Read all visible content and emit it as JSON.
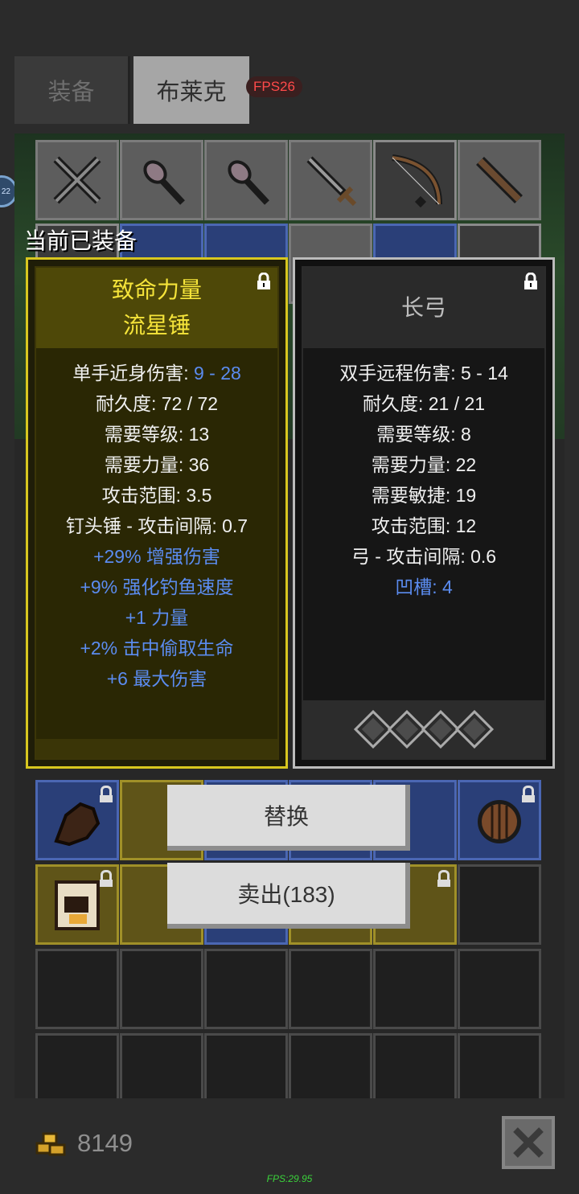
{
  "tabs": [
    {
      "label": "装备",
      "active": false
    },
    {
      "label": "布莱克",
      "active": true
    }
  ],
  "fps_badge": "FPS26",
  "side_bubble": "22",
  "section_label": "当前已装备",
  "equipped_item": {
    "name": "致命力量",
    "subtitle": "流星锤",
    "locked": true,
    "lines": [
      {
        "label": "单手近身伤害: ",
        "value": "9 - 28",
        "value_color": "blue"
      },
      {
        "label": "耐久度: 72 / 72"
      },
      {
        "label": "需要等级: 13"
      },
      {
        "label": "需要力量: 36"
      },
      {
        "label": "攻击范围: 3.5"
      },
      {
        "label": "钉头锤 - 攻击间隔: 0.7"
      },
      {
        "label": "+29% 增强伤害",
        "color": "blue"
      },
      {
        "label": "+9% 强化钓鱼速度",
        "color": "blue"
      },
      {
        "label": "+1 力量",
        "color": "blue"
      },
      {
        "label": "+2% 击中偷取生命",
        "color": "blue"
      },
      {
        "label": "+6 最大伤害",
        "color": "blue"
      }
    ]
  },
  "compare_item": {
    "name": "长弓",
    "locked": true,
    "lines": [
      {
        "label": "双手远程伤害: 5 - 14"
      },
      {
        "label": "耐久度: 21 / 21"
      },
      {
        "label": "需要等级: 8"
      },
      {
        "label": "需要力量: 22"
      },
      {
        "label": "需要敏捷: 19"
      },
      {
        "label": "攻击范围: 12"
      },
      {
        "label": "弓 - 攻击间隔: 0.6"
      },
      {
        "label": "凹槽: 4",
        "color": "blue"
      }
    ],
    "sockets": 4
  },
  "buttons": {
    "replace": "替换",
    "sell": "卖出(183)"
  },
  "gold": "8149",
  "fps_text": "FPS:29.95",
  "colors": {
    "gold_border": "#d8c71f",
    "gold_title": "#f5e43a",
    "blue_text": "#5b8cf0",
    "fps_red": "#ff4a4a",
    "fps_green": "#3bd43b"
  },
  "icons": {
    "close": "close-x-icon",
    "gold": "gold-coins-icon",
    "lock": "padlock-icon"
  }
}
